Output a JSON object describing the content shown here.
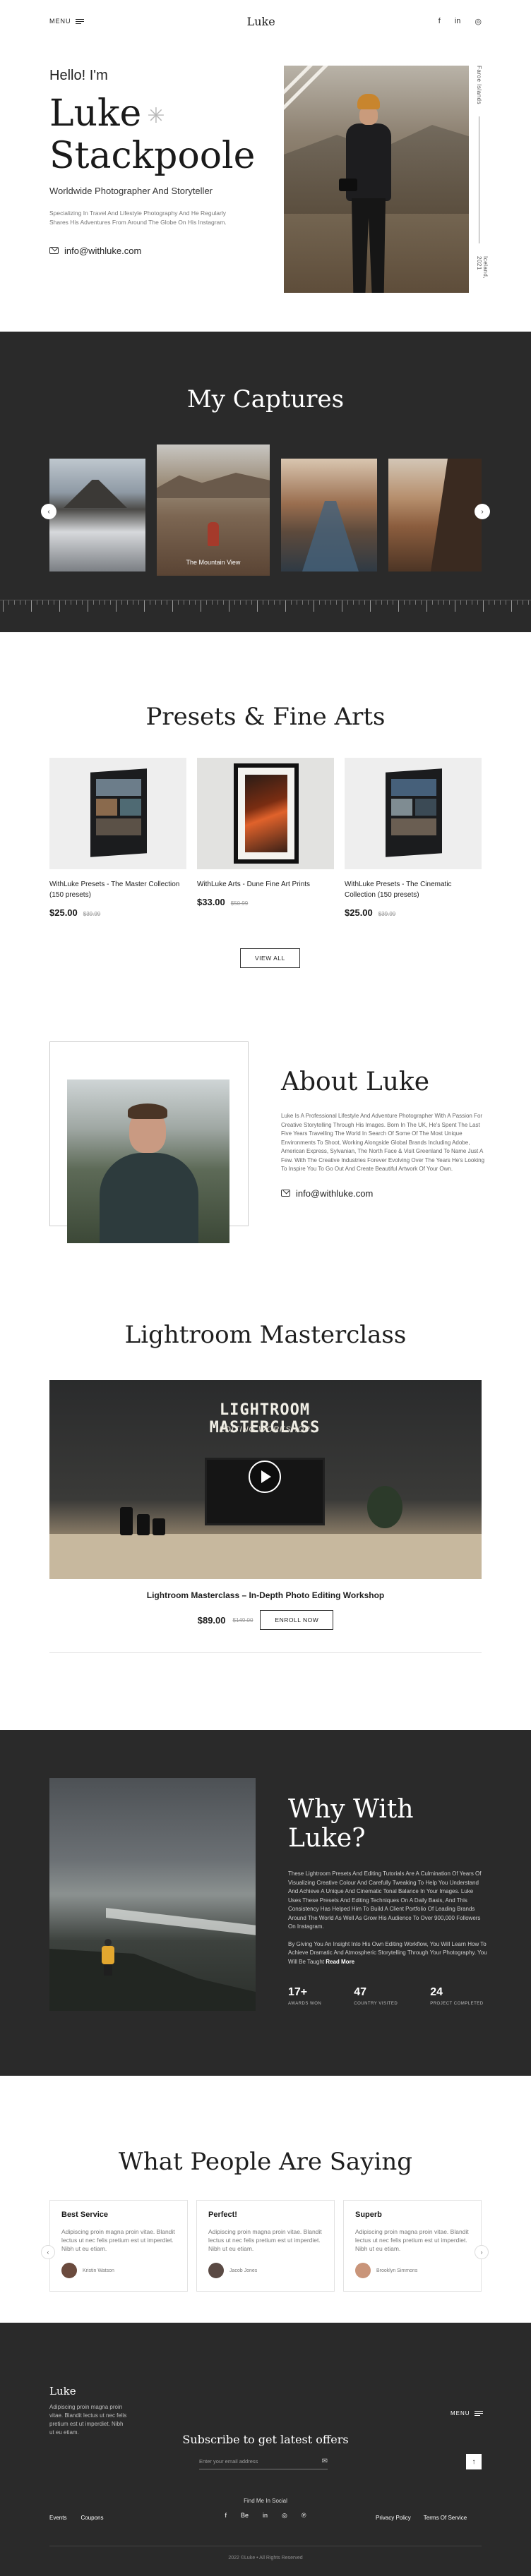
{
  "header": {
    "menu_label": "MENU",
    "logo": "Luke",
    "social": [
      "f",
      "in",
      "◎"
    ]
  },
  "hero": {
    "hello": "Hello! I'm",
    "first_name": "Luke",
    "last_name": "Stackpoole",
    "subtitle": "Worldwide Photographer And Storyteller",
    "description": "Specializing In Travel And Lifestyle Photography And He Regularly Shares His Adventures From Around The Globe On His Instagram.",
    "email": "info@withluke.com",
    "side_top": "Faroe Islands",
    "side_bottom": "Iceland, 2021"
  },
  "captures": {
    "title": "My Captures",
    "featured_label": "The Mountain View",
    "prev": "‹",
    "next": "›"
  },
  "presets": {
    "title": "Presets & Fine Arts",
    "products": [
      {
        "name": "WithLuke Presets - The Master Collection (150 presets)",
        "price": "$25.00",
        "old_price": "$39.99"
      },
      {
        "name": "WithLuke Arts - Dune Fine Art Prints",
        "price": "$33.00",
        "old_price": "$50.99"
      },
      {
        "name": "WithLuke Presets - The Cinematic Collection (150 presets)",
        "price": "$25.00",
        "old_price": "$39.99"
      }
    ],
    "view_all": "VIEW ALL"
  },
  "about": {
    "title": "About Luke",
    "description": "Luke Is A Professional Lifestyle And Adventure Photographer With A Passion For Creative Storytelling Through His Images. Born In The UK, He's Spent The Last Five Years Travelling The World In Search Of Some Of The Most Unique Environments To Shoot, Working Alongside Global Brands Including Adobe, American Express, Sylvanian, The North Face & Visit Greenland To Name Just A Few. With The Creative Industries Forever Evolving Over The Years He's Looking To Inspire You To Go Out And Create Beautiful Artwork Of Your Own.",
    "email": "info@withluke.com"
  },
  "masterclass": {
    "title": "Lightroom Masterclass",
    "video_title": "LIGHTROOM MASTERCLASS",
    "video_subtitle": "EDITING WORKSHOP",
    "name": "Lightroom Masterclass – In-Depth Photo Editing Workshop",
    "price": "$89.00",
    "old_price": "$149.00",
    "enroll": "ENROLL NOW"
  },
  "why": {
    "title": "Why With Luke?",
    "p1": "These Lightroom Presets And Editing Tutorials Are A Culmination Of Years Of Visualizing Creative Colour And Carefully Tweaking To Help You Understand And Achieve A Unique And Cinematic Tonal Balance In Your Images. Luke Uses These Presets And Editing Techniques On A Daily Basis, And This Consistency Has Helped Him To Build A Client Portfolio Of Leading Brands Around The World As Well As Grow His Audience To Over 900,000 Followers On Instagram.",
    "p2": "By Giving You An Insight Into His Own Editing Workflow, You Will Learn How To Achieve Dramatic And Atmospheric Storytelling Through Your Photography. You Will Be Taught",
    "p2_bold": "Read More",
    "stats": [
      {
        "n": "17+",
        "l": "Awards Won"
      },
      {
        "n": "47",
        "l": "Country Visited"
      },
      {
        "n": "24",
        "l": "Project Completed"
      }
    ]
  },
  "testimonials": {
    "title": "What People Are Saying",
    "cards": [
      {
        "title": "Best Service",
        "body": "Adipiscing proin magna proin vitae. Blandit lectus ut nec felis pretium est ut imperdiet. Nibh ut eu etiam.",
        "name": "Kristin Watson"
      },
      {
        "title": "Perfect!",
        "body": "Adipiscing proin magna proin vitae. Blandit lectus ut nec felis pretium est ut imperdiet. Nibh ut eu etiam.",
        "name": "Jacob Jones"
      },
      {
        "title": "Superb",
        "body": "Adipiscing proin magna proin vitae. Blandit lectus ut nec felis pretium est ut imperdiet. Nibh ut eu etiam.",
        "name": "Brooklyn Simmons"
      }
    ],
    "prev": "‹",
    "next": "›"
  },
  "footer": {
    "logo": "Luke",
    "description": "Adipiscing proin magna proin vitae. Blandit lectus ut nec felis pretium est ut imperdiet. Nibh ut eu etiam.",
    "subscribe_title": "Subscribe to get latest offers",
    "email_placeholder": "Enter your email address",
    "send": "✉",
    "menu_label": "MENU",
    "to_top": "↑",
    "find_me": "Find Me In Social",
    "social": [
      "f",
      "Be",
      "in",
      "◎",
      "℗"
    ],
    "links_left": [
      "Events",
      "Coupons"
    ],
    "links_right": [
      "Privacy Policy",
      "Terms Of Service"
    ],
    "copyright": "2022 ©Luke • All Rights Reserved"
  }
}
